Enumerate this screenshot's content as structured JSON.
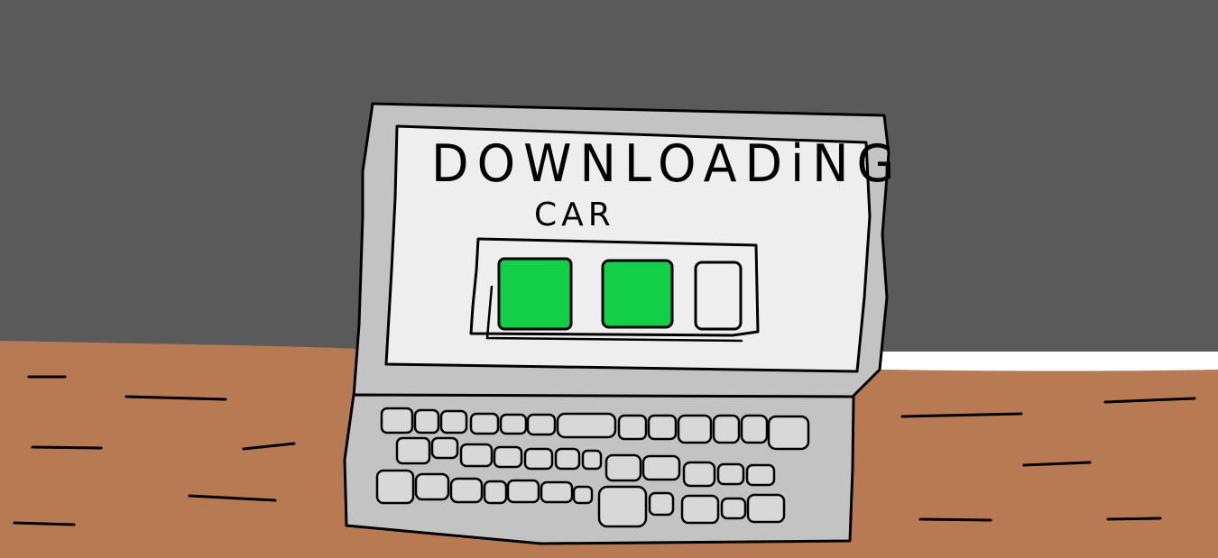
{
  "screen": {
    "title": "DOWNLOADiNG",
    "subtitle": "CAR"
  },
  "progress": {
    "filled_segments": 2,
    "total_segments": 3,
    "fraction": 0.667
  },
  "colors": {
    "wall": "#5a5a5a",
    "desk": "#b87a52",
    "laptop_body": "#c3c3c3",
    "screen_bg": "#eeeeee",
    "progress_fill": "#13cf48",
    "outline": "#000000"
  }
}
